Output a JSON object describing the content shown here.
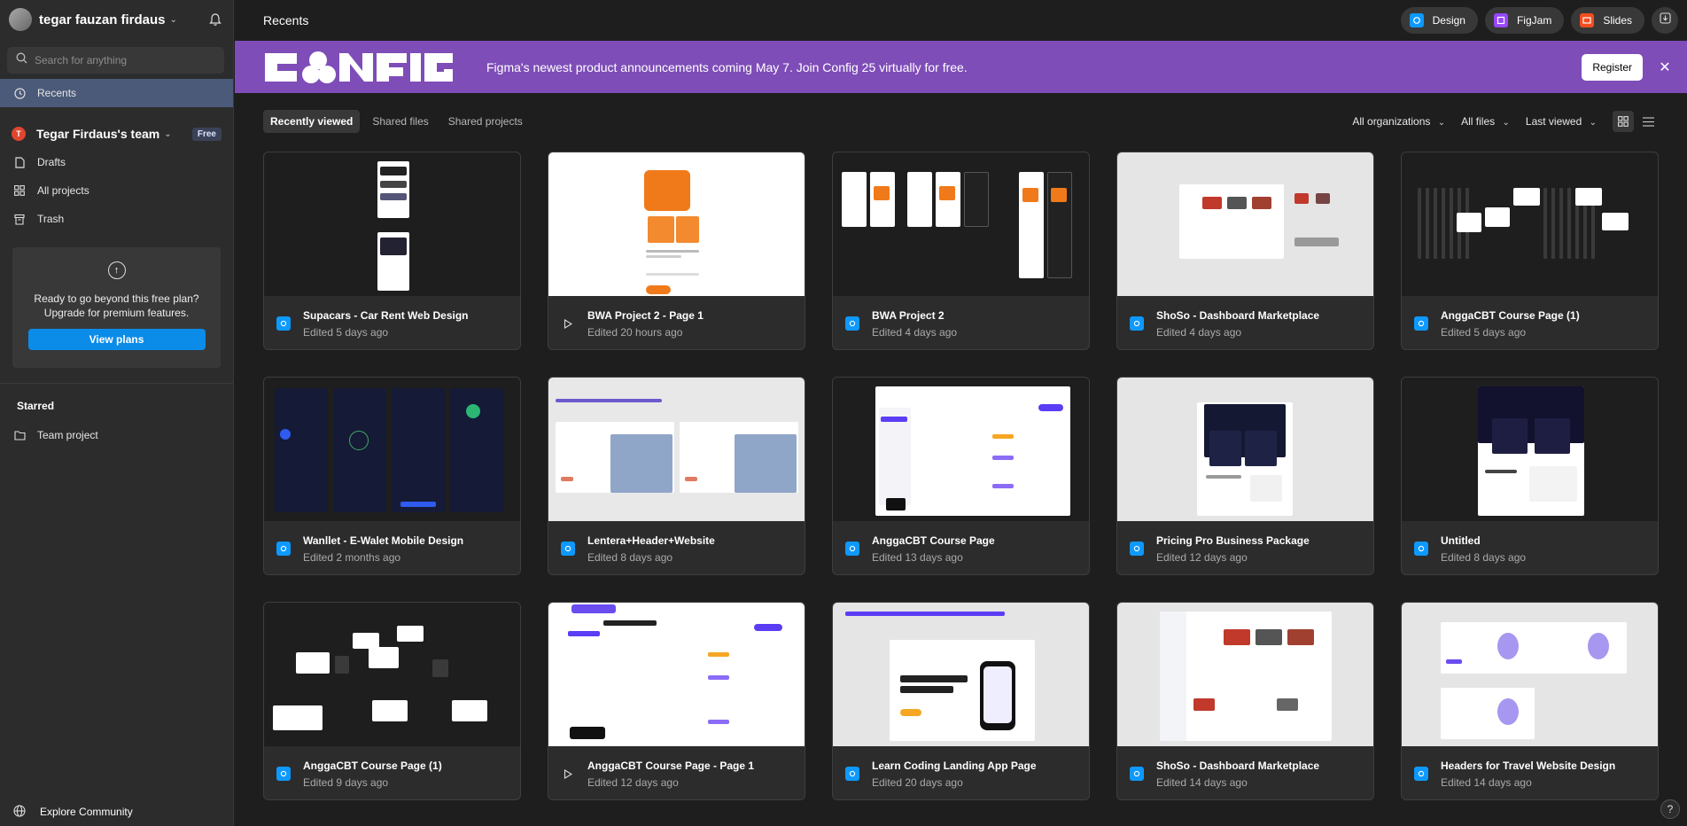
{
  "sidebar": {
    "user_name": "tegar fauzan firdaus",
    "search_placeholder": "Search for anything",
    "recents_label": "Recents",
    "team_initial": "T",
    "team_name": "Tegar Firdaus's team",
    "team_badge": "Free",
    "drafts_label": "Drafts",
    "all_projects_label": "All projects",
    "trash_label": "Trash",
    "upgrade_text_1": "Ready to go beyond this free plan?",
    "upgrade_text_2": "Upgrade for premium features.",
    "view_plans_label": "View plans",
    "starred_title": "Starred",
    "starred_item": "Team project",
    "explore_label": "Explore Community"
  },
  "header": {
    "title": "Recents",
    "design_label": "Design",
    "figjam_label": "FigJam",
    "slides_label": "Slides"
  },
  "banner": {
    "text": "Figma's newest product announcements coming May 7. Join Config 25 virtually for free.",
    "register_label": "Register",
    "accent": "#7e4db8"
  },
  "filters": {
    "tabs": [
      "Recently viewed",
      "Shared files",
      "Shared projects"
    ],
    "organizations": "All organizations",
    "files": "All files",
    "sort": "Last viewed"
  },
  "files": [
    {
      "title": "Supacars - Car Rent Web Design",
      "edited": "Edited 5 days ago",
      "icon": "design"
    },
    {
      "title": "BWA Project 2 - Page 1",
      "edited": "Edited 20 hours ago",
      "icon": "play"
    },
    {
      "title": "BWA Project 2",
      "edited": "Edited 4 days ago",
      "icon": "design"
    },
    {
      "title": "ShoSo - Dashboard Marketplace",
      "edited": "Edited 4 days ago",
      "icon": "design"
    },
    {
      "title": "AnggaCBT Course Page (1)",
      "edited": "Edited 5 days ago",
      "icon": "design"
    },
    {
      "title": "Wanllet - E-Walet Mobile Design",
      "edited": "Edited 2 months ago",
      "icon": "design"
    },
    {
      "title": "Lentera+Header+Website",
      "edited": "Edited 8 days ago",
      "icon": "design"
    },
    {
      "title": "AnggaCBT Course Page",
      "edited": "Edited 13 days ago",
      "icon": "design"
    },
    {
      "title": "Pricing Pro Business Package",
      "edited": "Edited 12 days ago",
      "icon": "design"
    },
    {
      "title": "Untitled",
      "edited": "Edited 8 days ago",
      "icon": "design"
    },
    {
      "title": "AnggaCBT Course Page (1)",
      "edited": "Edited 9 days ago",
      "icon": "design"
    },
    {
      "title": "AnggaCBT Course Page - Page 1",
      "edited": "Edited 12 days ago",
      "icon": "play"
    },
    {
      "title": "Learn Coding Landing App Page",
      "edited": "Edited 20 days ago",
      "icon": "design"
    },
    {
      "title": "ShoSo - Dashboard Marketplace",
      "edited": "Edited 14 days ago",
      "icon": "design"
    },
    {
      "title": "Headers for Travel Website Design",
      "edited": "Edited 14 days ago",
      "icon": "design"
    }
  ],
  "help_label": "?"
}
